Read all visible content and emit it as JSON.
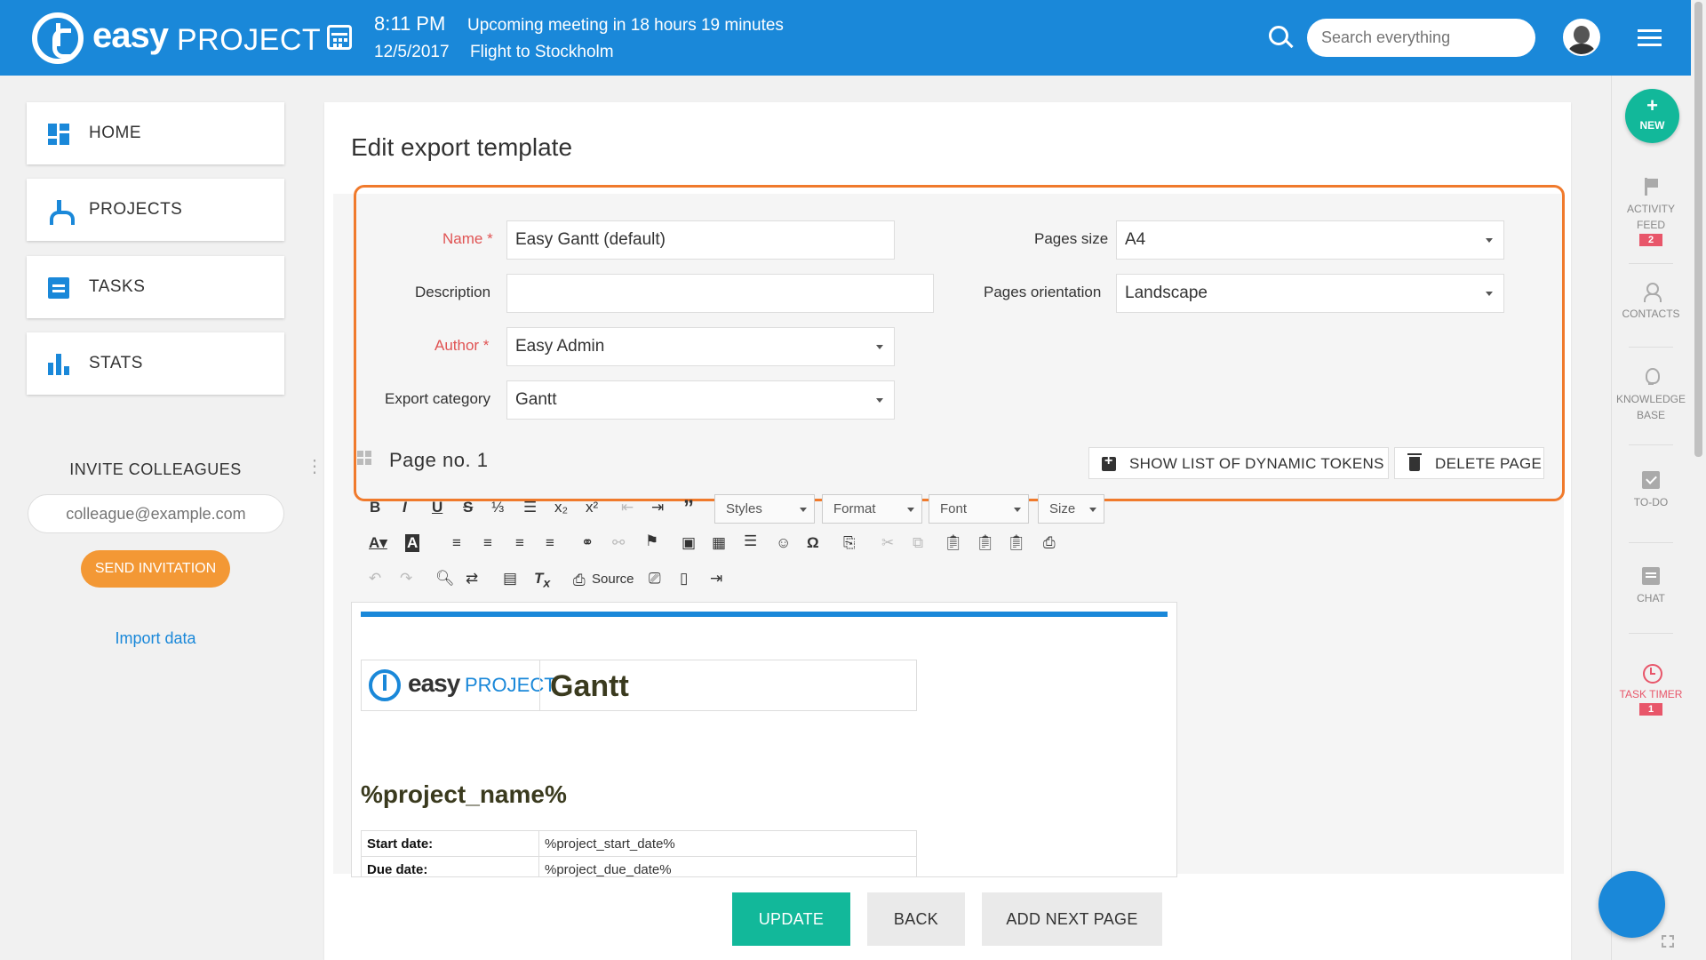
{
  "header": {
    "logo_bold": "easy",
    "logo_light": "PROJECT",
    "time": "8:11 PM",
    "date": "12/5/2017",
    "meeting": "Upcoming meeting in 18 hours 19 minutes",
    "flight": "Flight to Stockholm",
    "search_placeholder": "Search everything"
  },
  "sidebar": {
    "items": [
      {
        "label": "HOME",
        "icon": "dashboard-icon"
      },
      {
        "label": "PROJECTS",
        "icon": "projects-icon"
      },
      {
        "label": "TASKS",
        "icon": "clipboard-icon"
      },
      {
        "label": "STATS",
        "icon": "bar-chart-icon"
      }
    ],
    "invite_title": "INVITE COLLEAGUES",
    "invite_placeholder": "colleague@example.com",
    "send_label": "SEND INVITATION",
    "import_label": "Import data"
  },
  "form": {
    "title": "Edit export template",
    "name_label": "Name *",
    "name_value": "Easy Gantt (default)",
    "description_label": "Description",
    "description_value": "",
    "author_label": "Author *",
    "author_value": "Easy Admin",
    "category_label": "Export category",
    "category_value": "Gantt",
    "pages_size_label": "Pages size",
    "pages_size_value": "A4",
    "orientation_label": "Pages orientation",
    "orientation_value": "Landscape",
    "page_no": "Page no. 1",
    "show_tokens_label": "SHOW LIST OF DYNAMIC TOKENS",
    "delete_page_label": "DELETE PAGE"
  },
  "toolbar": {
    "styles": "Styles",
    "format": "Format",
    "font": "Font",
    "size": "Size",
    "source": "Source"
  },
  "document": {
    "logo_bold": "easy",
    "logo_light": "PROJECT",
    "heading": "Gantt",
    "project_name": "%project_name%",
    "rows": [
      {
        "label": "Start date:",
        "value": "%project_start_date%"
      },
      {
        "label": "Due date:",
        "value": "%project_due_date%"
      }
    ]
  },
  "actions": {
    "update": "UPDATE",
    "back": "BACK",
    "add_next": "ADD NEXT PAGE"
  },
  "right_sidebar": {
    "new_plus": "+",
    "new_label": "NEW",
    "activity_line1": "ACTIVITY",
    "activity_line2": "FEED",
    "activity_badge": "2",
    "contacts": "CONTACTS",
    "kb_line1": "KNOWLEDGE",
    "kb_line2": "BASE",
    "todo": "TO-DO",
    "chat": "CHAT",
    "timer": "TASK TIMER",
    "timer_badge": "1"
  },
  "colors": {
    "brand_blue": "#1a88d9",
    "highlight_orange": "#f07a2c",
    "update_green": "#12b89a",
    "invite_orange": "#f39835",
    "required_red": "#e05454"
  }
}
